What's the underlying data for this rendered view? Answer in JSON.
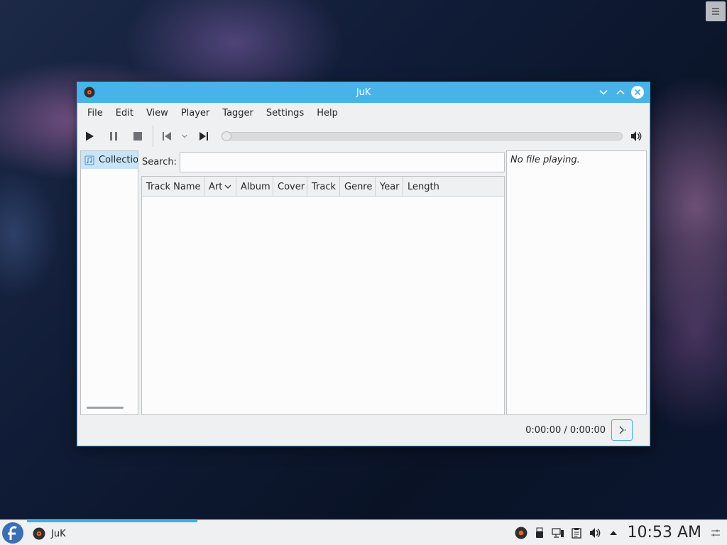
{
  "window": {
    "title": "JuK",
    "menu": [
      "File",
      "Edit",
      "View",
      "Player",
      "Tagger",
      "Settings",
      "Help"
    ]
  },
  "toolbar": {
    "icons": [
      "play-icon",
      "pause-icon",
      "stop-icon",
      "previous-icon",
      "previous-dropdown-icon",
      "next-icon",
      "volume-icon"
    ],
    "position_fraction": 0
  },
  "playlists": {
    "items": [
      {
        "label": "Collection"
      }
    ]
  },
  "search": {
    "label": "Search:",
    "value": ""
  },
  "table": {
    "columns": [
      "Track Name",
      "Artist",
      "Album",
      "Cover",
      "Track",
      "Genre",
      "Year",
      "Length"
    ],
    "sorted_column": "Artist",
    "rows": []
  },
  "now_playing": {
    "text": "No file playing."
  },
  "status": {
    "time": "0:00:00 / 0:00:00"
  },
  "taskbar": {
    "task_label": "JuK",
    "clock": "10:53 AM"
  },
  "colors": {
    "accent": "#3daee9",
    "titlebar": "#47b3ea",
    "selection": "#c8e4f7"
  }
}
